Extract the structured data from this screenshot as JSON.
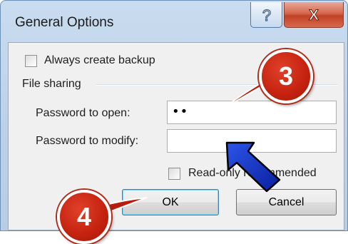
{
  "window": {
    "title": "General Options",
    "help_glyph": "?",
    "close_glyph": "X"
  },
  "options": {
    "always_backup_label": "Always create backup",
    "always_backup_checked": false,
    "group_label": "File sharing",
    "password_open_label": "Password to open:",
    "password_open_value": "••",
    "password_modify_label": "Password to modify:",
    "password_modify_value": "",
    "read_only_label": "Read-only recommended",
    "read_only_checked": false
  },
  "buttons": {
    "ok": "OK",
    "cancel": "Cancel"
  },
  "annotations": {
    "step3": "3",
    "step4": "4"
  },
  "colors": {
    "badge_red": "#c4220f",
    "arrow_blue": "#1033c9"
  }
}
